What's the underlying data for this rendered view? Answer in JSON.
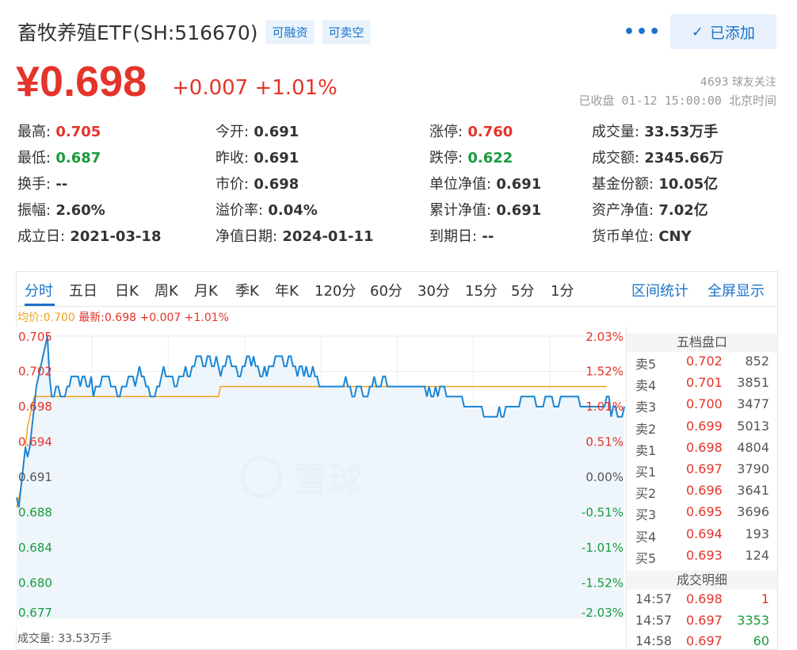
{
  "header": {
    "title": "畜牧养殖ETF(SH:516670)",
    "tags": [
      "可融资",
      "可卖空"
    ],
    "more": "•••",
    "added_label": "已添加"
  },
  "quote": {
    "price": "¥0.698",
    "change": "+0.007",
    "change_pct": "+1.01%",
    "followers": "4693 球友关注",
    "status": "已收盘 01-12 15:00:00 北京时间"
  },
  "stats": [
    {
      "label": "最高:",
      "value": "0.705",
      "color": "red"
    },
    {
      "label": "今开:",
      "value": "0.691",
      "color": ""
    },
    {
      "label": "涨停:",
      "value": "0.760",
      "color": "red"
    },
    {
      "label": "成交量:",
      "value": "33.53万手",
      "color": ""
    },
    {
      "label": "最低:",
      "value": "0.687",
      "color": "green"
    },
    {
      "label": "昨收:",
      "value": "0.691",
      "color": ""
    },
    {
      "label": "跌停:",
      "value": "0.622",
      "color": "green"
    },
    {
      "label": "成交额:",
      "value": "2345.66万",
      "color": ""
    },
    {
      "label": "换手:",
      "value": "--",
      "color": ""
    },
    {
      "label": "市价:",
      "value": "0.698",
      "color": ""
    },
    {
      "label": "单位净值:",
      "value": "0.691",
      "color": ""
    },
    {
      "label": "基金份额:",
      "value": "10.05亿",
      "color": ""
    },
    {
      "label": "振幅:",
      "value": "2.60%",
      "color": ""
    },
    {
      "label": "溢价率:",
      "value": "0.04%",
      "color": ""
    },
    {
      "label": "累计净值:",
      "value": "0.691",
      "color": ""
    },
    {
      "label": "资产净值:",
      "value": "7.02亿",
      "color": ""
    },
    {
      "label": "成立日:",
      "value": "2021-03-18",
      "color": ""
    },
    {
      "label": "净值日期:",
      "value": "2024-01-11",
      "color": ""
    },
    {
      "label": "到期日:",
      "value": "--",
      "color": ""
    },
    {
      "label": "货币单位:",
      "value": "CNY",
      "color": ""
    }
  ],
  "tabs": [
    "分时",
    "五日",
    "日K",
    "周K",
    "月K",
    "季K",
    "年K",
    "120分",
    "60分",
    "30分",
    "15分",
    "5分",
    "1分"
  ],
  "tabs_right": [
    "区间统计",
    "全屏显示"
  ],
  "chart_header": {
    "avg": "均价:0.700",
    "latest": "最新:0.698 +0.007 +1.01%"
  },
  "chart_data": {
    "type": "line",
    "y_left_ticks": [
      "0.705",
      "0.702",
      "0.698",
      "0.694",
      "0.691",
      "0.688",
      "0.684",
      "0.680",
      "0.677"
    ],
    "y_right_ticks": [
      "2.03%",
      "1.52%",
      "1.01%",
      "0.51%",
      "0.00%",
      "-0.51%",
      "-1.01%",
      "-1.52%",
      "-2.03%"
    ],
    "ylim": [
      0.677,
      0.705
    ],
    "series": [
      {
        "values": [
          0.689,
          0.688,
          0.69,
          0.692,
          0.694,
          0.693,
          0.694,
          0.696,
          0.698,
          0.7,
          0.701,
          0.702,
          0.703,
          0.704,
          0.705,
          0.701,
          0.699,
          0.699,
          0.7,
          0.7,
          0.699,
          0.699,
          0.699,
          0.7,
          0.7,
          0.701,
          0.701,
          0.701,
          0.701,
          0.7,
          0.701,
          0.701,
          0.7,
          0.7,
          0.701,
          0.699,
          0.7,
          0.7,
          0.7,
          0.701,
          0.701,
          0.701,
          0.701,
          0.7,
          0.7,
          0.7,
          0.699,
          0.699,
          0.7,
          0.7,
          0.7,
          0.701,
          0.701,
          0.701,
          0.7,
          0.701,
          0.702,
          0.701,
          0.701,
          0.7,
          0.7,
          0.699,
          0.699,
          0.699,
          0.7,
          0.7,
          0.701,
          0.702,
          0.701,
          0.701,
          0.701,
          0.701,
          0.7,
          0.7,
          0.701,
          0.701,
          0.701,
          0.702,
          0.701,
          0.701,
          0.702,
          0.702,
          0.703,
          0.703,
          0.703,
          0.702,
          0.702,
          0.703,
          0.703,
          0.702,
          0.702,
          0.703,
          0.702,
          0.701,
          0.702,
          0.702,
          0.703,
          0.703,
          0.702,
          0.702,
          0.702,
          0.701,
          0.701,
          0.702,
          0.702,
          0.703,
          0.703,
          0.702,
          0.703,
          0.702,
          0.702,
          0.701,
          0.701,
          0.702,
          0.701,
          0.702,
          0.702,
          0.702,
          0.703,
          0.703,
          0.703,
          0.703,
          0.702,
          0.702,
          0.703,
          0.703,
          0.702,
          0.702,
          0.701,
          0.702,
          0.702,
          0.701,
          0.702,
          0.701,
          0.701,
          0.702,
          0.701,
          0.701,
          0.7,
          0.7,
          0.7,
          0.7,
          0.7,
          0.7,
          0.7,
          0.7,
          0.7,
          0.7,
          0.7,
          0.7,
          0.701,
          0.7,
          0.7,
          0.699,
          0.699,
          0.7,
          0.7,
          0.7,
          0.699,
          0.699,
          0.699,
          0.7,
          0.7,
          0.701,
          0.7,
          0.7,
          0.7,
          0.701,
          0.701,
          0.7,
          0.7,
          0.7,
          0.7,
          0.7,
          0.7,
          0.7,
          0.7,
          0.7,
          0.7,
          0.7,
          0.7,
          0.7,
          0.7,
          0.7,
          0.7,
          0.7,
          0.7,
          0.699,
          0.7,
          0.699,
          0.699,
          0.7,
          0.699,
          0.7,
          0.7,
          0.7,
          0.699,
          0.699,
          0.699,
          0.699,
          0.699,
          0.699,
          0.699,
          0.699,
          0.698,
          0.698,
          0.698,
          0.698,
          0.698,
          0.698,
          0.698,
          0.698,
          0.698,
          0.697,
          0.697,
          0.697,
          0.697,
          0.697,
          0.697,
          0.697,
          0.698,
          0.697,
          0.697,
          0.698,
          0.698,
          0.698,
          0.698,
          0.698,
          0.698,
          0.698,
          0.699,
          0.699,
          0.699,
          0.699,
          0.699,
          0.699,
          0.699,
          0.698,
          0.698,
          0.698,
          0.698,
          0.699,
          0.699,
          0.699,
          0.699,
          0.698,
          0.698,
          0.698,
          0.699,
          0.699,
          0.699,
          0.699,
          0.699,
          0.699,
          0.699,
          0.699,
          0.699,
          0.698,
          0.698,
          0.698,
          0.698,
          0.698,
          0.698,
          0.698,
          0.698,
          0.698,
          0.698,
          0.698,
          0.698,
          0.699,
          0.699,
          0.697,
          0.698,
          0.698,
          0.697,
          0.697,
          0.697,
          0.698
        ]
      },
      {
        "values": [
          0.688,
          0.689,
          0.69,
          0.692,
          0.694,
          0.696,
          0.697,
          0.698,
          0.699,
          0.699,
          0.699,
          0.699,
          0.699,
          0.699,
          0.699,
          0.699,
          0.699,
          0.699,
          0.699,
          0.699,
          0.699,
          0.699,
          0.699,
          0.699,
          0.699,
          0.699,
          0.699,
          0.699,
          0.699,
          0.699,
          0.699,
          0.699,
          0.699,
          0.699,
          0.699,
          0.699,
          0.699,
          0.699,
          0.699,
          0.699,
          0.699,
          0.699,
          0.699,
          0.699,
          0.699,
          0.699,
          0.699,
          0.699,
          0.699,
          0.699,
          0.699,
          0.699,
          0.699,
          0.699,
          0.699,
          0.699,
          0.699,
          0.699,
          0.699,
          0.699,
          0.699,
          0.699,
          0.699,
          0.699,
          0.699,
          0.699,
          0.699,
          0.699,
          0.699,
          0.699,
          0.699,
          0.699,
          0.699,
          0.699,
          0.699,
          0.699,
          0.699,
          0.699,
          0.699,
          0.699,
          0.699,
          0.699,
          0.699,
          0.699,
          0.699,
          0.699,
          0.699,
          0.699,
          0.699,
          0.699,
          0.699,
          0.699,
          0.699,
          0.7,
          0.7,
          0.7,
          0.7,
          0.7,
          0.7,
          0.7,
          0.7,
          0.7,
          0.7,
          0.7,
          0.7,
          0.7,
          0.7,
          0.7,
          0.7,
          0.7,
          0.7,
          0.7,
          0.7,
          0.7,
          0.7,
          0.7,
          0.7,
          0.7,
          0.7,
          0.7,
          0.7,
          0.7,
          0.7,
          0.7,
          0.7,
          0.7,
          0.7,
          0.7,
          0.7,
          0.7,
          0.7,
          0.7,
          0.7,
          0.7,
          0.7,
          0.7,
          0.7,
          0.7,
          0.7,
          0.7,
          0.7,
          0.7,
          0.7,
          0.7,
          0.7,
          0.7,
          0.7,
          0.7,
          0.7,
          0.7,
          0.7,
          0.7,
          0.7,
          0.7,
          0.7,
          0.7,
          0.7,
          0.7,
          0.7,
          0.7,
          0.7,
          0.7,
          0.7,
          0.7,
          0.7,
          0.7,
          0.7,
          0.7,
          0.7,
          0.7,
          0.7,
          0.7,
          0.7,
          0.7,
          0.7,
          0.7,
          0.7,
          0.7,
          0.7,
          0.7,
          0.7,
          0.7,
          0.7,
          0.7,
          0.7,
          0.7,
          0.7,
          0.7,
          0.7,
          0.7,
          0.7,
          0.7,
          0.7,
          0.7,
          0.7,
          0.7,
          0.7,
          0.7,
          0.7,
          0.7,
          0.7,
          0.7,
          0.7,
          0.7,
          0.7,
          0.7,
          0.7,
          0.7,
          0.7,
          0.7,
          0.7,
          0.7,
          0.7,
          0.7,
          0.7,
          0.7,
          0.7,
          0.7,
          0.7,
          0.7,
          0.7,
          0.7,
          0.7,
          0.7,
          0.7,
          0.7,
          0.7,
          0.7,
          0.7,
          0.7,
          0.7,
          0.7,
          0.7,
          0.7,
          0.7,
          0.7,
          0.7,
          0.7,
          0.7,
          0.7,
          0.7,
          0.7,
          0.7,
          0.7,
          0.7,
          0.7,
          0.7,
          0.7,
          0.7,
          0.7,
          0.7,
          0.7,
          0.7,
          0.7,
          0.7,
          0.7,
          0.7,
          0.7,
          0.7,
          0.7,
          0.7,
          0.7,
          0.7,
          0.7,
          0.7,
          0.7,
          0.7,
          0.7,
          0.7,
          0.7
        ]
      }
    ]
  },
  "watermark": "雪球",
  "volume_label": "成交量: 33.53万手",
  "orderbook": {
    "title": "五档盘口",
    "rows": [
      {
        "label": "卖5",
        "price": "0.702",
        "qty": "852"
      },
      {
        "label": "卖4",
        "price": "0.701",
        "qty": "3851"
      },
      {
        "label": "卖3",
        "price": "0.700",
        "qty": "3477"
      },
      {
        "label": "卖2",
        "price": "0.699",
        "qty": "5013"
      },
      {
        "label": "卖1",
        "price": "0.698",
        "qty": "4804"
      },
      {
        "label": "买1",
        "price": "0.697",
        "qty": "3790"
      },
      {
        "label": "买2",
        "price": "0.696",
        "qty": "3641"
      },
      {
        "label": "买3",
        "price": "0.695",
        "qty": "3696"
      },
      {
        "label": "买4",
        "price": "0.694",
        "qty": "193"
      },
      {
        "label": "买5",
        "price": "0.693",
        "qty": "124"
      }
    ],
    "trades_title": "成交明细",
    "trades": [
      {
        "time": "14:57",
        "price": "0.698",
        "qty": "1",
        "qty_color": "red"
      },
      {
        "time": "14:57",
        "price": "0.697",
        "qty": "3353",
        "qty_color": "green"
      },
      {
        "time": "14:58",
        "price": "0.697",
        "qty": "60",
        "qty_color": "green"
      }
    ]
  },
  "colors": {
    "up": "#e4342b",
    "down": "#1a9a3d",
    "accent": "#1a73c9",
    "price_line": "#1a86d6",
    "avg_line": "#f2a11b",
    "area_fill": "#eaf4fb"
  }
}
